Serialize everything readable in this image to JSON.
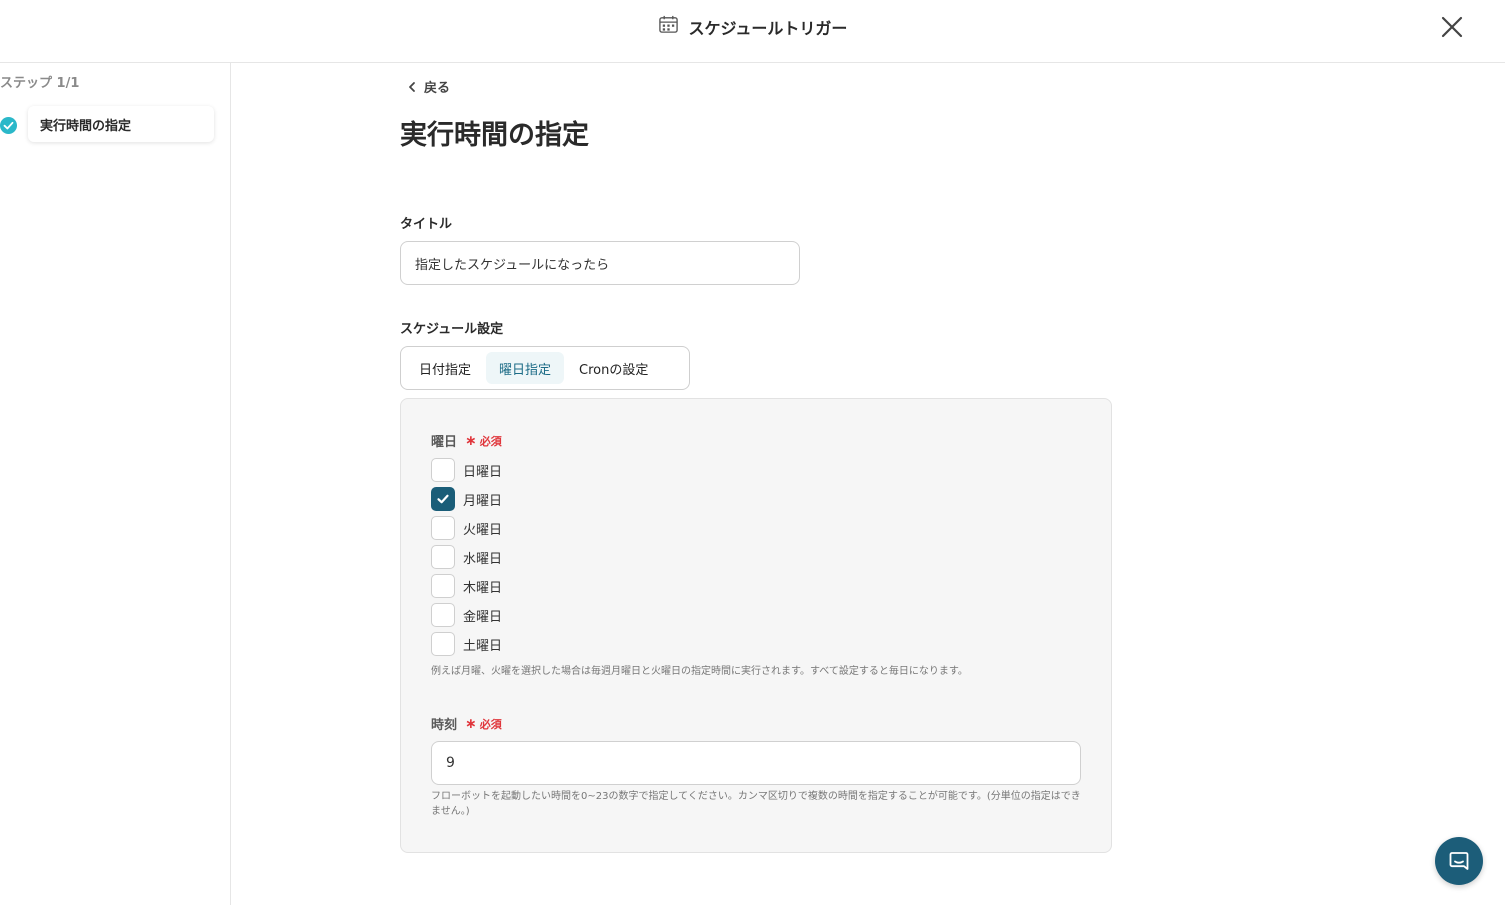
{
  "header": {
    "title": "スケジュールトリガー",
    "icon": "calendar-icon"
  },
  "sidebar": {
    "step_count": "ステップ 1/1",
    "steps": [
      {
        "label": "実行時間の指定",
        "completed": true
      }
    ]
  },
  "main": {
    "back_label": "戻る",
    "page_title": "実行時間の指定",
    "title_field": {
      "label": "タイトル",
      "value": "指定したスケジュールになったら"
    },
    "schedule": {
      "label": "スケジュール設定",
      "tabs": [
        {
          "label": "日付指定",
          "active": false
        },
        {
          "label": "曜日指定",
          "active": true
        },
        {
          "label": "Cronの設定",
          "active": false
        }
      ]
    },
    "weekday": {
      "label": "曜日",
      "required_label": "必須",
      "options": [
        {
          "label": "日曜日",
          "checked": false
        },
        {
          "label": "月曜日",
          "checked": true
        },
        {
          "label": "火曜日",
          "checked": false
        },
        {
          "label": "水曜日",
          "checked": false
        },
        {
          "label": "木曜日",
          "checked": false
        },
        {
          "label": "金曜日",
          "checked": false
        },
        {
          "label": "土曜日",
          "checked": false
        }
      ],
      "help": "例えば月曜、火曜を選択した場合は毎週月曜日と火曜日の指定時間に実行されます。すべて設定すると毎日になります。"
    },
    "hour": {
      "label": "時刻",
      "required_label": "必須",
      "value": "9",
      "help": "フローボットを起動したい時間を0~23の数字で指定してください。カンマ区切りで複数の時間を指定することが可能です。(分単位の指定はできません。)"
    }
  },
  "colors": {
    "accent": "#1a5d78",
    "required": "#e0353b",
    "step_check": "#2bb8c9"
  }
}
